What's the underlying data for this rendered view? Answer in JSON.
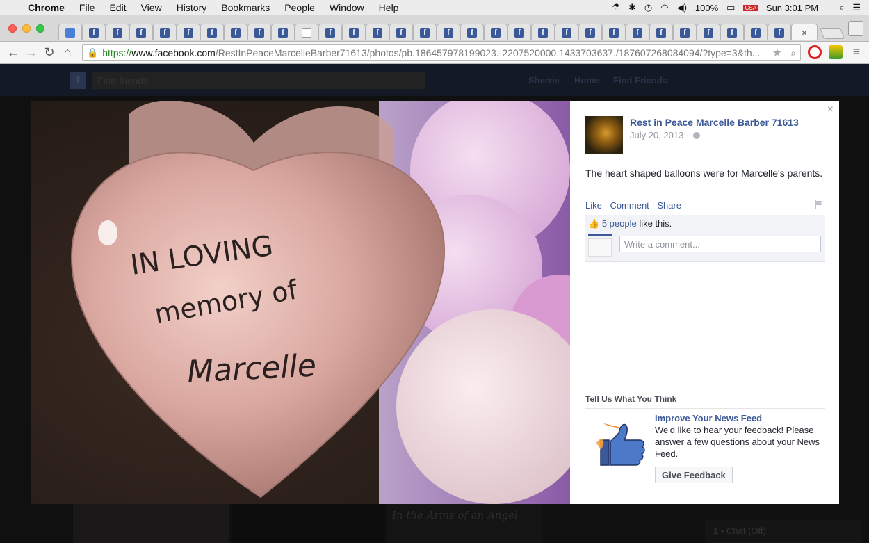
{
  "menubar": {
    "app": "Chrome",
    "items": [
      "File",
      "Edit",
      "View",
      "History",
      "Bookmarks",
      "People",
      "Window",
      "Help"
    ],
    "battery": "100%",
    "input_source": "CSA",
    "clock": "Sun 3:01 PM"
  },
  "browser": {
    "url_scheme": "https://",
    "url_host": "www.facebook.com",
    "url_path": "/RestInPeaceMarcelleBarber71613/photos/pb.186457978199023.-2207520000.1433703637./187607268084094/?type=3&th...",
    "tab_favicon_letter": "f"
  },
  "facebook_bg": {
    "search_placeholder": "Find friends",
    "nav_user": "Sherrie",
    "nav_home": "Home",
    "nav_find_friends": "Find Friends",
    "thumb_caption": "In the Arms of an Angel",
    "chat": "1 • Chat (Off)"
  },
  "post": {
    "page_name": "Rest in Peace Marcelle Barber 71613",
    "date": "July 20, 2013 ·",
    "caption": "The heart shaped balloons were for Marcelle's parents.",
    "actions": {
      "like": "Like",
      "comment": "Comment",
      "share": "Share"
    },
    "likes_count": "5 people",
    "likes_suffix": " like this.",
    "comment_placeholder": "Write a comment...",
    "photo_text": [
      "IN LOVING",
      "memory of",
      "Marcelle"
    ]
  },
  "feedback": {
    "section_title": "Tell Us What You Think",
    "title": "Improve Your News Feed",
    "body": "We'd like to hear your feedback! Please answer a few questions about your News Feed.",
    "button": "Give Feedback"
  }
}
